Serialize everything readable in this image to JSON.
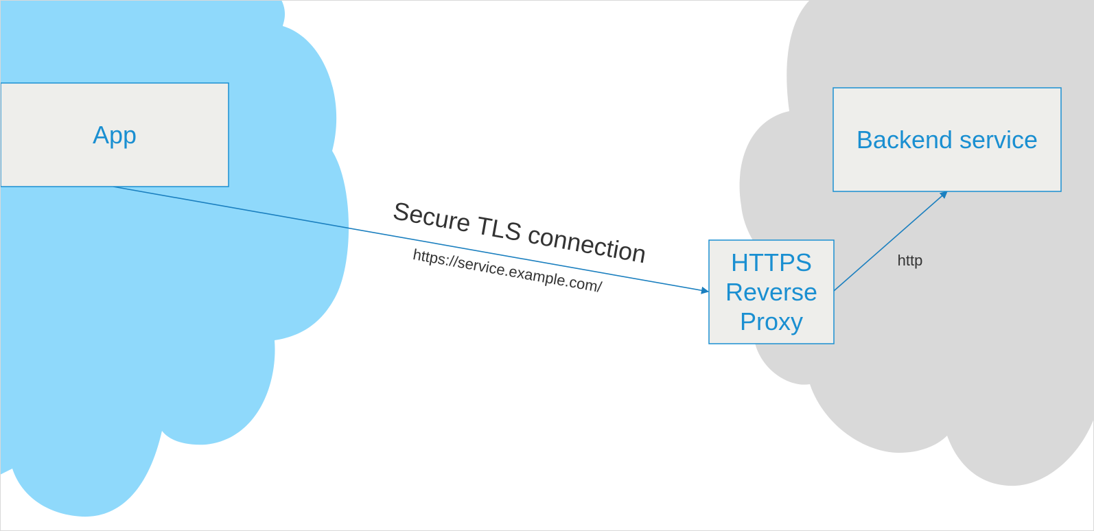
{
  "colors": {
    "client_cloud": "#8fd9fb",
    "server_cloud": "#d9d9d9",
    "box_fill": "#eeeeeb",
    "box_stroke": "#1a8fd1",
    "box_text": "#1a8fd1",
    "arrow": "#1a7fbf",
    "edge_text": "#333333"
  },
  "nodes": {
    "app": {
      "label": "App"
    },
    "proxy": {
      "lines": [
        "HTTPS",
        "Reverse",
        "Proxy"
      ]
    },
    "backend": {
      "label": "Backend service"
    }
  },
  "edges": {
    "tls": {
      "label": "Secure TLS connection",
      "sublabel": "https://service.example.com/"
    },
    "http": {
      "label": "http"
    }
  }
}
